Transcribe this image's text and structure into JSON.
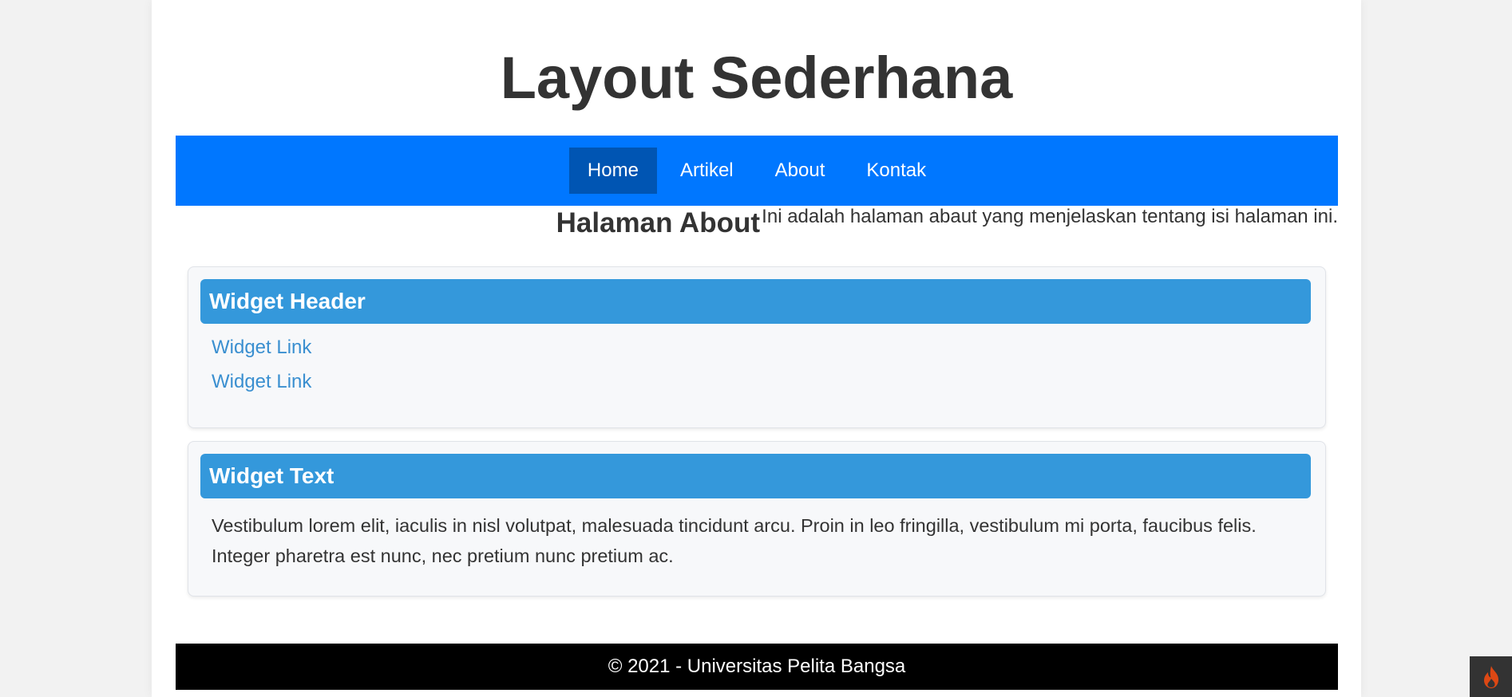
{
  "site": {
    "title": "Layout Sederhana"
  },
  "nav": {
    "items": [
      {
        "label": "Home",
        "active": true
      },
      {
        "label": "Artikel",
        "active": false
      },
      {
        "label": "About",
        "active": false
      },
      {
        "label": "Kontak",
        "active": false
      }
    ]
  },
  "content": {
    "heading": "Halaman About",
    "text": "Ini adalah halaman abaut yang menjelaskan tentang isi halaman ini."
  },
  "widgets": {
    "links": {
      "header": "Widget Header",
      "items": [
        "Widget Link",
        "Widget Link"
      ]
    },
    "text": {
      "header": "Widget Text",
      "body": "Vestibulum lorem elit, iaculis in nisl volutpat, malesuada tincidunt arcu. Proin in leo fringilla, vestibulum mi porta, faucibus felis. Integer pharetra est nunc, nec pretium nunc pretium ac."
    }
  },
  "footer": {
    "text": "© 2021 - Universitas Pelita Bangsa"
  },
  "toolbar": {
    "icon": "flame-icon"
  },
  "colors": {
    "nav_background": "#0077ff",
    "nav_active": "#0055b3",
    "widget_header": "#3498db",
    "link": "#3a8fd0",
    "footer_background": "#000000",
    "toolbar_flame": "#dd4814"
  }
}
